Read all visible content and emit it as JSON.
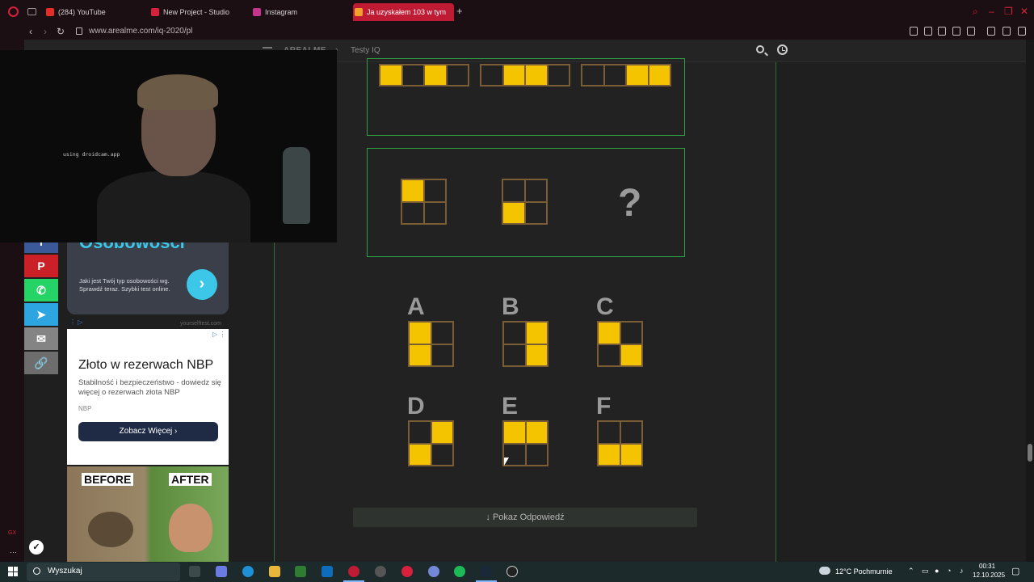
{
  "browser": {
    "tabs": [
      {
        "label": "(284) YouTube",
        "color": "#e52d27"
      },
      {
        "label": "New Project - Studio",
        "color": "#d6203c"
      },
      {
        "label": "Instagram",
        "color": "#c1358d"
      },
      {
        "label": "Ja uzyskałem 103 w tym",
        "color": "#f2a22c"
      }
    ],
    "url": "www.arealme.com/iq-2020/pl"
  },
  "site": {
    "brand": "AREALME",
    "breadcrumb_sep": "›",
    "breadcrumb": "Testy IQ"
  },
  "share": {
    "buttons": [
      {
        "icon": "facebook-icon",
        "glyph": "f",
        "color": "#3b5998"
      },
      {
        "icon": "pinterest-icon",
        "glyph": "P",
        "color": "#cb2027"
      },
      {
        "icon": "whatsapp-icon",
        "glyph": "✆",
        "color": "#25d366"
      },
      {
        "icon": "telegram-icon",
        "glyph": "➤",
        "color": "#2ca5e0"
      },
      {
        "icon": "email-icon",
        "glyph": "✉",
        "color": "#848484"
      },
      {
        "icon": "link-icon",
        "glyph": "🔗",
        "color": "#6d6d6d"
      }
    ]
  },
  "ads": {
    "personality": {
      "title": "Osobowości",
      "text": "Jaki jest Twój typ osobowości wg. Sprawdź teraz. Szybki test online.",
      "source": "yourselftest.com"
    },
    "gold": {
      "title": "Złoto w rezerwach NBP",
      "desc": "Stabilność i bezpieczeństwo - dowiedz się więcej o rezerwach złota NBP",
      "brand": "NBP",
      "cta": "Zobacz Więcej ›"
    },
    "beforeafter": {
      "before": "BEFORE",
      "after": "AFTER"
    }
  },
  "webcam": {
    "overlay_text": "using droidcam.app"
  },
  "puzzle": {
    "top_row_strips": [
      [
        true,
        false,
        true,
        false
      ],
      [
        false,
        true,
        true,
        false
      ],
      [
        false,
        false,
        true,
        true
      ]
    ],
    "middle_sequence": [
      [
        true,
        false,
        false,
        false
      ],
      [
        false,
        false,
        true,
        false
      ]
    ],
    "question_mark": "?",
    "options": [
      {
        "letter": "A",
        "cells": [
          true,
          false,
          true,
          false
        ]
      },
      {
        "letter": "B",
        "cells": [
          false,
          true,
          false,
          true
        ]
      },
      {
        "letter": "C",
        "cells": [
          true,
          false,
          false,
          true
        ]
      },
      {
        "letter": "D",
        "cells": [
          false,
          true,
          true,
          false
        ]
      },
      {
        "letter": "E",
        "cells": [
          true,
          true,
          false,
          false
        ]
      },
      {
        "letter": "F",
        "cells": [
          false,
          false,
          true,
          true
        ]
      }
    ],
    "reveal_button": "↓ Pokaz Odpowiedź",
    "colors": {
      "filled": "#f5c400",
      "border": "#7a5d35",
      "frame": "#2ea043"
    }
  },
  "taskbar": {
    "search_label": "Wyszukaj",
    "weather": "12°C Pochmurnie",
    "time": "00:31",
    "date": "12.10.2025"
  }
}
